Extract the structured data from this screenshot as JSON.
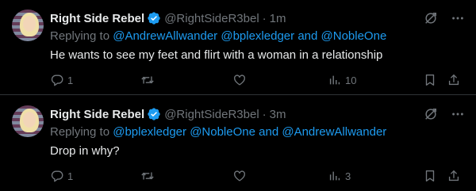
{
  "colors": {
    "background": "#000000",
    "text": "#e7e9ea",
    "muted": "#71767b",
    "link": "#1d9bf0",
    "divider": "#2f3336"
  },
  "tweets": [
    {
      "author_name": "Right Side Rebel",
      "handle": "@RightSideR3bel",
      "separator": "·",
      "time": "1m",
      "replying_prefix": "Replying to",
      "mentions": [
        "@AndrewAllwander",
        "@bplexledger"
      ],
      "and_word": "and",
      "last_mention": "@NobleOne",
      "text": "He wants to see my feet and flirt with a woman in a relationship",
      "replies": "1",
      "retweets": "",
      "likes": "",
      "views": "10",
      "icons": [
        "reply-icon",
        "retweet-icon",
        "like-icon",
        "views-icon",
        "bookmark-icon",
        "share-icon",
        "grok-icon",
        "more-icon",
        "verified-icon"
      ]
    },
    {
      "author_name": "Right Side Rebel",
      "handle": "@RightSideR3bel",
      "separator": "·",
      "time": "3m",
      "replying_prefix": "Replying to",
      "mentions": [
        "@bplexledger",
        "@NobleOne"
      ],
      "and_word": "and",
      "last_mention": "@AndrewAllwander",
      "text": "Drop in why?",
      "replies": "1",
      "retweets": "",
      "likes": "",
      "views": "3",
      "icons": [
        "reply-icon",
        "retweet-icon",
        "like-icon",
        "views-icon",
        "bookmark-icon",
        "share-icon",
        "grok-icon",
        "more-icon",
        "verified-icon"
      ]
    }
  ]
}
